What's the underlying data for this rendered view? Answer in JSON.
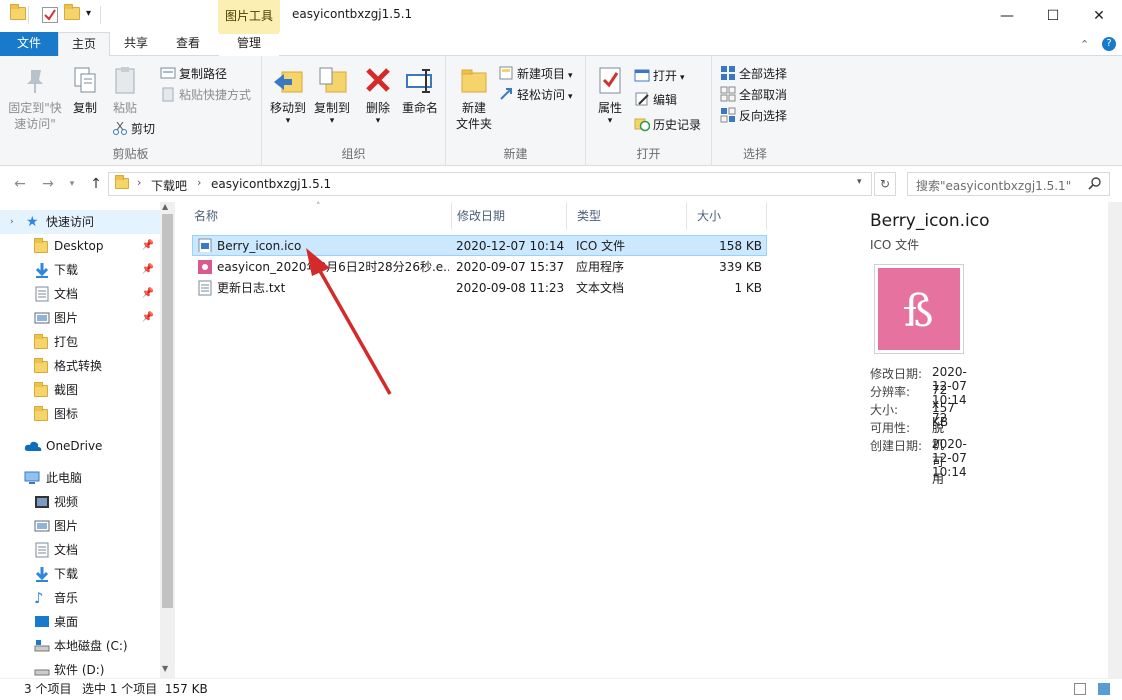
{
  "titlebar": {
    "context_tab": "图片工具",
    "title": "easyicontbxzgj1.5.1",
    "minimize": "—",
    "maximize": "☐",
    "close": "✕"
  },
  "tabs": {
    "file": "文件",
    "home": "主页",
    "share": "共享",
    "view": "查看",
    "manage": "管理",
    "help_icon": "?"
  },
  "ribbon": {
    "clipboard": {
      "label": "剪贴板",
      "pin": "固定到\"快速访问\"",
      "copy": "复制",
      "paste": "粘贴",
      "copy_path": "复制路径",
      "paste_shortcut": "粘贴快捷方式",
      "cut": "剪切"
    },
    "organize": {
      "label": "组织",
      "move_to": "移动到",
      "copy_to": "复制到",
      "delete": "删除",
      "rename": "重命名"
    },
    "new": {
      "label": "新建",
      "new_folder": "新建\n文件夹",
      "new_item": "新建项目",
      "easy_access": "轻松访问"
    },
    "open": {
      "label": "打开",
      "properties": "属性",
      "open": "打开",
      "edit": "编辑",
      "history": "历史记录"
    },
    "select": {
      "label": "选择",
      "select_all": "全部选择",
      "select_none": "全部取消",
      "invert": "反向选择"
    }
  },
  "address": {
    "segments": [
      "下载吧",
      "easyicontbxzgj1.5.1"
    ],
    "search_placeholder": "搜索\"easyicontbxzgj1.5.1\""
  },
  "sidebar": {
    "quick_access": "快速访问",
    "items": [
      {
        "label": "Desktop",
        "pinned": true
      },
      {
        "label": "下载",
        "pinned": true
      },
      {
        "label": "文档",
        "pinned": true
      },
      {
        "label": "图片",
        "pinned": true
      },
      {
        "label": "打包",
        "pinned": false
      },
      {
        "label": "格式转换",
        "pinned": false
      },
      {
        "label": "截图",
        "pinned": false
      },
      {
        "label": "图标",
        "pinned": false
      }
    ],
    "onedrive": "OneDrive",
    "this_pc": "此电脑",
    "pc_items": [
      "视频",
      "图片",
      "文档",
      "下载",
      "音乐",
      "桌面",
      "本地磁盘 (C:)",
      "软件 (D:)"
    ]
  },
  "columns": {
    "name": "名称",
    "modified": "修改日期",
    "type": "类型",
    "size": "大小"
  },
  "files": [
    {
      "name": "Berry_icon.ico",
      "modified": "2020-12-07 10:14",
      "type": "ICO 文件",
      "size": "158 KB"
    },
    {
      "name": "easyicon_2020年8月6日2时28分26秒.e...",
      "modified": "2020-09-07 15:37",
      "type": "应用程序",
      "size": "339 KB"
    },
    {
      "name": "更新日志.txt",
      "modified": "2020-09-08 11:23",
      "type": "文本文档",
      "size": "1 KB"
    }
  ],
  "preview": {
    "filename": "Berry_icon.ico",
    "filetype": "ICO 文件",
    "props": [
      {
        "k": "修改日期:",
        "v": "2020-12-07 10:14"
      },
      {
        "k": "分辨率:",
        "v": "72 x 72"
      },
      {
        "k": "大小:",
        "v": "157 KB"
      },
      {
        "k": "可用性:",
        "v": "脱机可用"
      },
      {
        "k": "创建日期:",
        "v": "2020-12-07 10:14"
      }
    ]
  },
  "status": {
    "count": "3 个项目",
    "selected": "选中 1 个项目  157 KB"
  },
  "colors": {
    "accent": "#1979ca",
    "selection": "#cce8ff",
    "context_tab": "#fcefb4",
    "arrow": "#d42a2a"
  }
}
